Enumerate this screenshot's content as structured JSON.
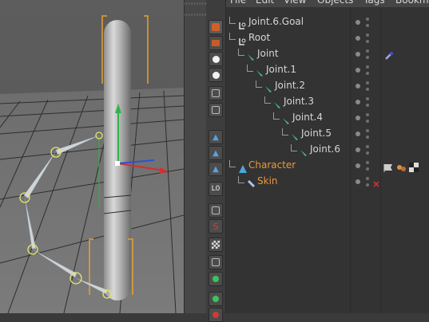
{
  "menu": {
    "items": [
      "File",
      "Edit",
      "View",
      "Objects",
      "Tags",
      "Bookm"
    ]
  },
  "objects": [
    {
      "label": "Joint.6.Goal",
      "depth": 1,
      "icon": "null-icon",
      "color": "normal"
    },
    {
      "label": "Root",
      "depth": 1,
      "icon": "null-icon",
      "color": "normal"
    },
    {
      "label": "Joint",
      "depth": 2,
      "icon": "joint-icon",
      "color": "normal"
    },
    {
      "label": "Joint.1",
      "depth": 3,
      "icon": "joint-icon",
      "color": "normal"
    },
    {
      "label": "Joint.2",
      "depth": 4,
      "icon": "joint-icon",
      "color": "normal"
    },
    {
      "label": "Joint.3",
      "depth": 5,
      "icon": "joint-icon",
      "color": "normal"
    },
    {
      "label": "Joint.4",
      "depth": 6,
      "icon": "joint-icon",
      "color": "normal"
    },
    {
      "label": "Joint.5",
      "depth": 7,
      "icon": "joint-icon",
      "color": "normal"
    },
    {
      "label": "Joint.6",
      "depth": 8,
      "icon": "joint-icon",
      "color": "normal"
    },
    {
      "label": "Character",
      "depth": 1,
      "icon": "character-icon",
      "color": "orange"
    },
    {
      "label": "Skin",
      "depth": 2,
      "icon": "skin-icon",
      "color": "orange"
    }
  ],
  "tools": [
    "phong-tool-icon",
    "texture-tool-icon",
    "sphere-white-icon",
    "sphere-white-icon",
    "figure-icon",
    "objects-icon",
    "arrow-up-icon",
    "arrow-up-icon",
    "arrow-up-icon",
    "null-tool-icon",
    "ik-icon",
    "spline-icon",
    "checker-icon",
    "bone-icon",
    "green-sphere-icon",
    "green-sphere-icon",
    "red-sphere-icon"
  ],
  "colors": {
    "accent_orange": "#e89a3a",
    "axis_x": "#d03030",
    "axis_y": "#2fb34a",
    "axis_z": "#3050d0"
  }
}
